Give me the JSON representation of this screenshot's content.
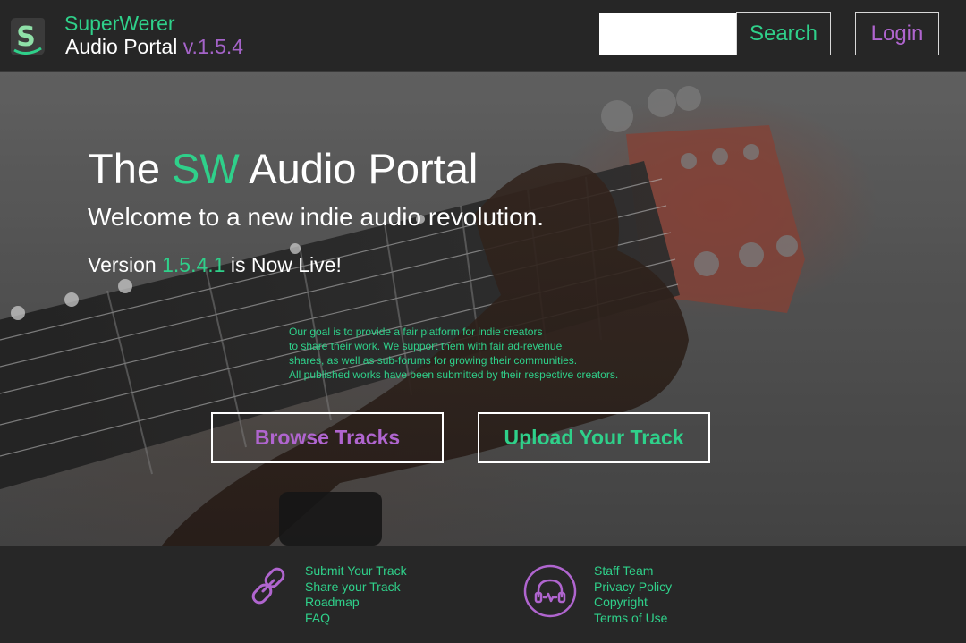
{
  "header": {
    "brand_name": "SuperWerer",
    "brand_sub": "Audio Portal ",
    "brand_version": "v.1.5.4",
    "logo_icon": "s-letter-logo",
    "search_placeholder": "",
    "search_label": "Search",
    "login_label": "Login"
  },
  "hero": {
    "title_pre": "The ",
    "title_accent": "SW",
    "title_post": " Audio Portal",
    "subtitle": "Welcome to a new indie audio revolution.",
    "version_pre": "Version ",
    "version_num": "1.5.4.1",
    "version_post": " is Now Live!",
    "mission_lines": [
      "Our goal is to provide a fair platform for indie creators",
      "to share their work. We support them with fair ad-revenue",
      "shares, as well as sub-forums for growing their communities.",
      "All published works have been submitted  by their respective creators."
    ],
    "browse_label": "Browse Tracks",
    "upload_label": "Upload Your Track",
    "background_image": "guitar-headstock-photo"
  },
  "footer": {
    "left_icon": "link-icon",
    "left_links": [
      "Submit Your Track",
      "Share your Track",
      "Roadmap",
      "FAQ"
    ],
    "right_icon": "headphones-icon",
    "right_links": [
      "Staff Team",
      "Privacy Policy",
      "Copyright",
      "Terms of Use"
    ]
  },
  "colors": {
    "accent_green": "#2fd08a",
    "accent_purple": "#b065cf",
    "header_bg": "#262626",
    "footer_bg": "#272727"
  }
}
